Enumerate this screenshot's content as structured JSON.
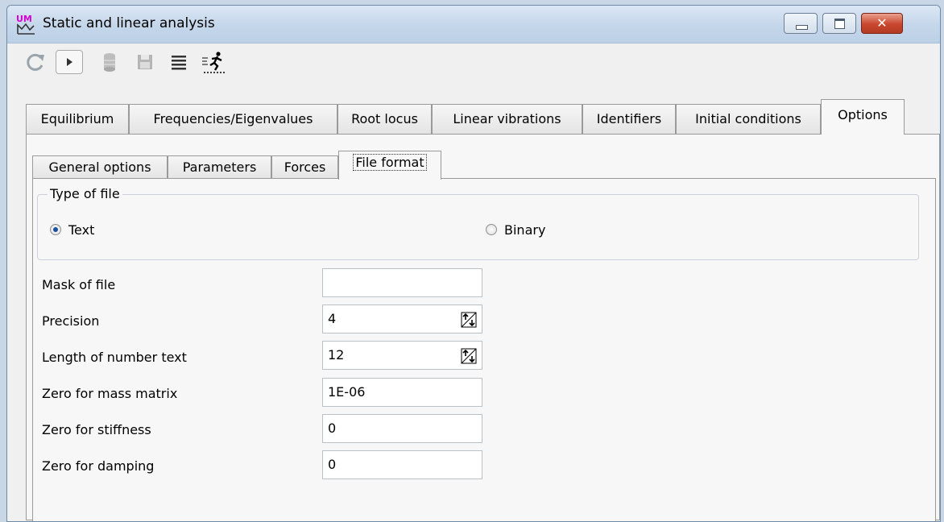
{
  "window": {
    "title": "Static and linear analysis",
    "close_glyph": "✕"
  },
  "toolbar": {
    "icons": [
      "refresh-icon",
      "run-icon",
      "database-icon",
      "save-icon",
      "list-icon",
      "running-man-icon"
    ]
  },
  "main_tabs": [
    {
      "label": "Equilibrium"
    },
    {
      "label": "Frequencies/Eigenvalues"
    },
    {
      "label": "Root locus"
    },
    {
      "label": "Linear vibrations"
    },
    {
      "label": "Identifiers"
    },
    {
      "label": "Initial conditions"
    },
    {
      "label": "Options",
      "active": true
    }
  ],
  "sub_tabs": [
    {
      "label": "General options"
    },
    {
      "label": "Parameters"
    },
    {
      "label": "Forces"
    },
    {
      "label": "File format",
      "active": true
    }
  ],
  "file_type": {
    "legend": "Type of file",
    "options": [
      {
        "label": "Text",
        "checked": true
      },
      {
        "label": "Binary",
        "checked": false
      }
    ]
  },
  "fields": [
    {
      "label": "Mask of file",
      "value": ""
    },
    {
      "label": "Precision",
      "value": "4",
      "spinner": true
    },
    {
      "label": "Length of number text",
      "value": "12",
      "spinner": true
    },
    {
      "label": "Zero for mass matrix",
      "value": "1E-06"
    },
    {
      "label": "Zero for stiffness",
      "value": "0"
    },
    {
      "label": "Zero for damping",
      "value": "0"
    }
  ],
  "colors": {
    "accent": "#1a4fa0",
    "close": "#c9462d",
    "icon_magenta": "#d400d4"
  }
}
